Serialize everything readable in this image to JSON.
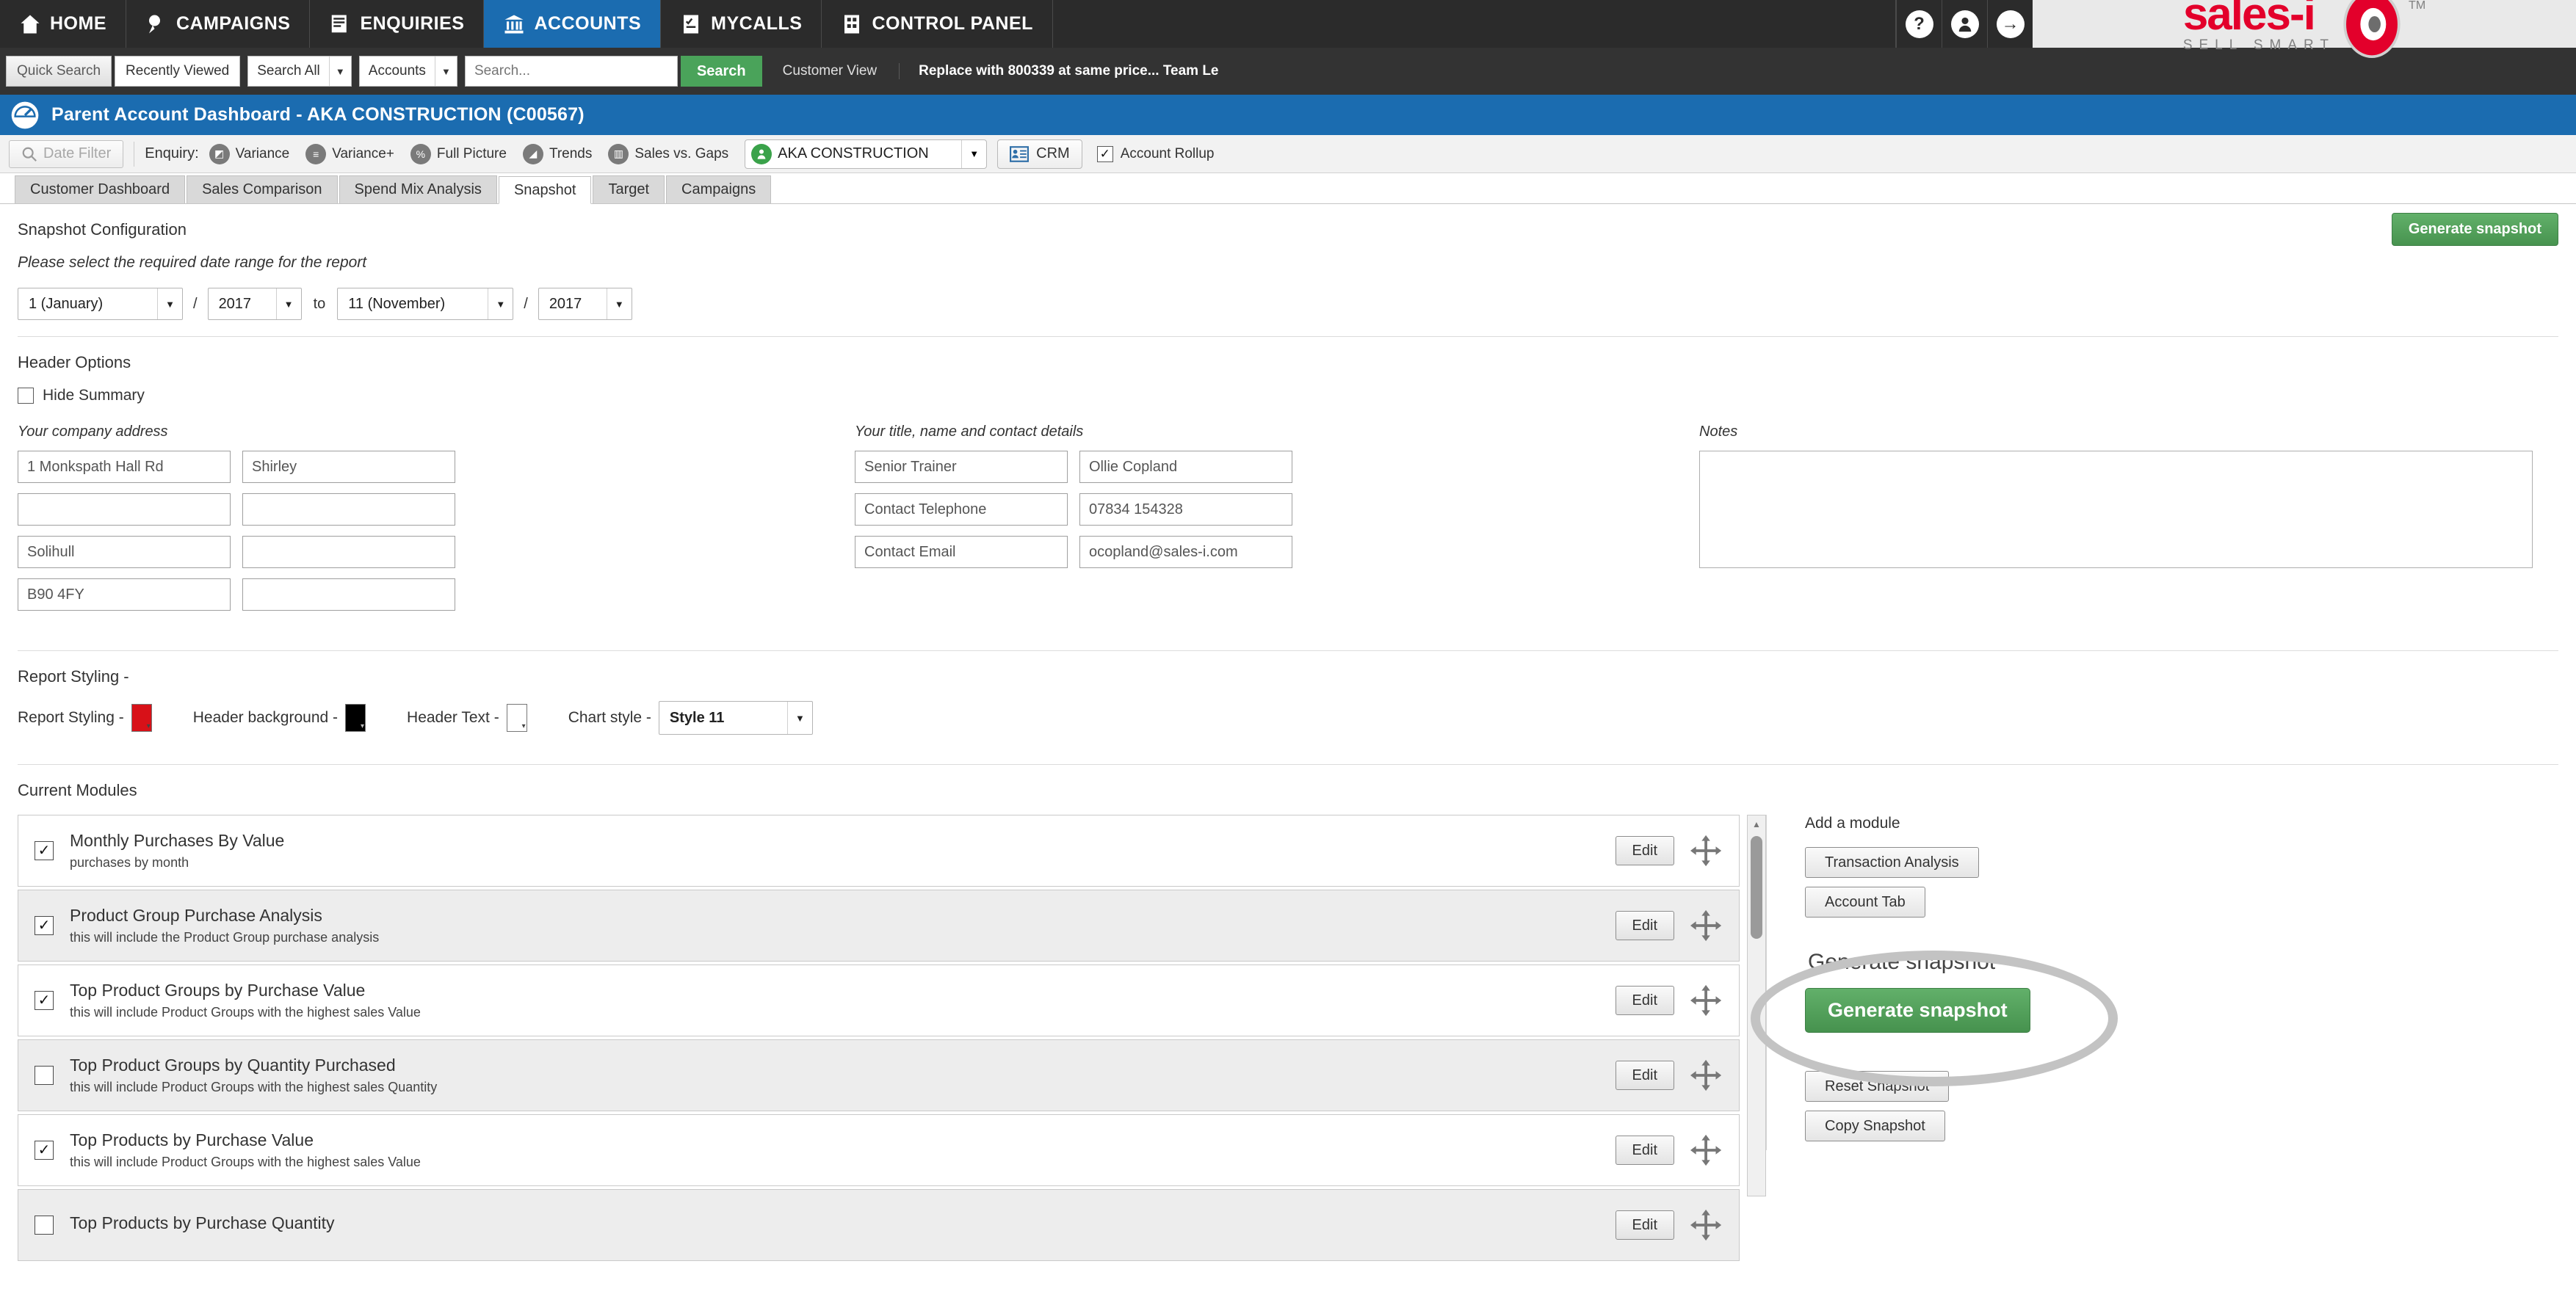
{
  "topnav": {
    "items": [
      {
        "label": "HOME",
        "icon": "home-icon",
        "active": false
      },
      {
        "label": "CAMPAIGNS",
        "icon": "campaigns-icon",
        "active": false
      },
      {
        "label": "ENQUIRIES",
        "icon": "enquiries-icon",
        "active": false
      },
      {
        "label": "ACCOUNTS",
        "icon": "accounts-icon",
        "active": true
      },
      {
        "label": "MYCALLS",
        "icon": "mycalls-icon",
        "active": false
      },
      {
        "label": "CONTROL PANEL",
        "icon": "control-panel-icon",
        "active": false
      }
    ],
    "help_icon": "question-mark-icon",
    "user_icon": "user-avatar-icon",
    "logout_icon": "arrow-right-icon",
    "logo_text": "sales-i",
    "logo_tagline": "SELL SMART",
    "logo_tm": "TM",
    "logo_color": "#e3002b"
  },
  "searchbar": {
    "quick_search": "Quick Search",
    "recently_viewed": "Recently Viewed",
    "scope_select": "Search All",
    "type_select": "Accounts",
    "search_placeholder": "Search...",
    "search_button": "Search",
    "customer_view": "Customer View",
    "note": "Replace with 800339 at same price... Team Le",
    "search_button_color": "#4aa35a"
  },
  "titlebar": {
    "icon": "dashboard-gauge-icon",
    "title": "Parent Account Dashboard - AKA CONSTRUCTION (C00567)",
    "color": "#1b6cb0"
  },
  "enquirybar": {
    "date_filter": "Date Filter",
    "date_filter_icon": "search-icon",
    "enquiry_label": "Enquiry:",
    "items": [
      {
        "label": "Variance",
        "icon": "variance-icon"
      },
      {
        "label": "Variance+",
        "icon": "variance-plus-icon"
      },
      {
        "label": "Full Picture",
        "icon": "full-picture-icon"
      },
      {
        "label": "Trends",
        "icon": "trends-icon"
      },
      {
        "label": "Sales vs. Gaps",
        "icon": "sales-vs-gaps-icon"
      }
    ],
    "account_name": "AKA CONSTRUCTION",
    "account_icon": "account-person-icon",
    "crm_label": "CRM",
    "crm_icon": "crm-card-icon",
    "account_rollup_label": "Account Rollup",
    "account_rollup_checked": true
  },
  "tabs": [
    {
      "label": "Customer Dashboard",
      "active": false
    },
    {
      "label": "Sales Comparison",
      "active": false
    },
    {
      "label": "Spend Mix Analysis",
      "active": false
    },
    {
      "label": "Snapshot",
      "active": true
    },
    {
      "label": "Target",
      "active": false
    },
    {
      "label": "Campaigns",
      "active": false
    }
  ],
  "snapshot_config": {
    "heading": "Snapshot Configuration",
    "instruction": "Please select the required date range for the report",
    "generate_top_label": "Generate snapshot",
    "from_month": "1 (January)",
    "from_year": "2017",
    "to_word": "to",
    "to_month": "11 (November)",
    "to_year": "2017",
    "separator": "/"
  },
  "header_options": {
    "heading": "Header Options",
    "hide_summary_label": "Hide Summary",
    "hide_summary_checked": false,
    "address_label": "Your company address",
    "address_rows": [
      {
        "left": "1 Monkspath Hall Rd",
        "right": "Shirley"
      },
      {
        "left": "",
        "right": ""
      },
      {
        "left": "Solihull",
        "right": ""
      },
      {
        "left": "B90 4FY",
        "right": ""
      }
    ],
    "contact_label": "Your title, name and contact details",
    "contact_rows": [
      {
        "left": "Senior Trainer",
        "right": "Ollie Copland"
      },
      {
        "left": "Contact Telephone",
        "right": "07834 154328"
      },
      {
        "left": "Contact Email",
        "right": "ocopland@sales-i.com"
      }
    ],
    "notes_label": "Notes",
    "notes_value": ""
  },
  "report_styling": {
    "heading": "Report Styling -",
    "report_styling_label": "Report Styling -",
    "report_styling_color": "#d81118",
    "header_background_label": "Header background -",
    "header_background_color": "#000000",
    "header_text_label": "Header Text -",
    "header_text_color": "#ffffff",
    "chart_style_label": "Chart style -",
    "chart_style_value": "Style 11"
  },
  "modules": {
    "heading": "Current Modules",
    "edit_label": "Edit",
    "move_icon": "move-handle-icon",
    "rows": [
      {
        "title": "Monthly Purchases By Value",
        "desc": "purchases by month",
        "checked": true
      },
      {
        "title": "Product Group Purchase Analysis",
        "desc": "this will include the Product Group purchase analysis",
        "checked": true
      },
      {
        "title": "Top Product Groups by Purchase Value",
        "desc": "this will include Product Groups with the highest sales Value",
        "checked": true
      },
      {
        "title": "Top Product Groups by Quantity Purchased",
        "desc": "this will include Product Groups with the highest sales Quantity",
        "checked": false
      },
      {
        "title": "Top Products by Purchase Value",
        "desc": "this will include Product Groups with the highest sales Value",
        "checked": true
      },
      {
        "title": "Top Products by Purchase Quantity",
        "desc": "",
        "checked": false
      }
    ]
  },
  "add_module": {
    "heading": "Add a module",
    "buttons": [
      "Transaction Analysis",
      "Account Tab"
    ],
    "generate_heading": "Generate snapshot",
    "generate_button": "Generate snapshot",
    "reset_button": "Reset Snapshot",
    "copy_button": "Copy Snapshot",
    "highlight_color": "#c3c3c3"
  }
}
